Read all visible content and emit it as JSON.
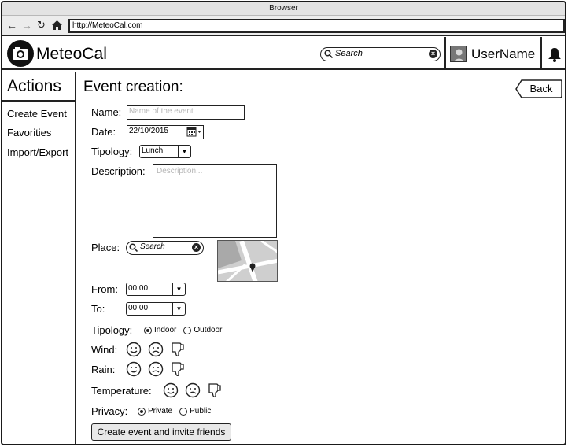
{
  "browser": {
    "title": "Browser",
    "url": "http://MeteoCal.com"
  },
  "header": {
    "app_name": "MeteoCal",
    "search_placeholder": "Search",
    "username": "UserName"
  },
  "sidebar": {
    "title": "Actions",
    "items": [
      {
        "label": "Create Event"
      },
      {
        "label": "Favorities"
      },
      {
        "label": "Import/Export"
      }
    ]
  },
  "form": {
    "title": "Event creation:",
    "back_label": "Back",
    "name_label": "Name:",
    "name_placeholder": "Name of the event",
    "date_label": "Date:",
    "date_value": "22/10/2015",
    "tipology_label": "Tipology:",
    "tipology_value": "Lunch",
    "description_label": "Description:",
    "description_placeholder": "Description...",
    "place_label": "Place:",
    "place_placeholder": "Search",
    "from_label": "From:",
    "from_value": "00:00",
    "to_label": "To:",
    "to_value": "00:00",
    "tipology2_label": "Tipology:",
    "tipology2_options": [
      "Indoor",
      "Outdoor"
    ],
    "tipology2_selected": "Indoor",
    "wind_label": "Wind:",
    "rain_label": "Rain:",
    "temperature_label": "Temperature:",
    "condition_icons": [
      "smile-icon",
      "frown-icon",
      "thumbs-down-icon"
    ],
    "privacy_label": "Privacy:",
    "privacy_options": [
      "Private",
      "Public"
    ],
    "privacy_selected": "Private",
    "submit_label": "Create event and invite friends"
  }
}
